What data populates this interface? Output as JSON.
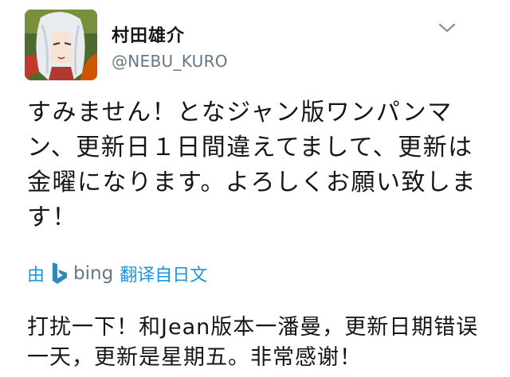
{
  "user": {
    "display_name": "村田雄介",
    "handle": "@NEBU_KURO"
  },
  "tweet": {
    "text": "すみません！となジャン版ワンパンマン、更新日１日間違えてまして、更新は金曜になります。よろしくお願い致します！"
  },
  "translation": {
    "by_label": "由",
    "provider_name": "bing",
    "link_label": "翻译自日文",
    "text": "打扰一下！和Jean版本一潘曼，更新日期错误一天，更新是星期五。非常感谢！"
  },
  "icons": {
    "menu": "chevron-down-icon",
    "provider": "bing-logo-icon"
  },
  "colors": {
    "link": "#1b95e0",
    "secondary_text": "#657786",
    "primary_text": "#14171a",
    "bing_logo": "#2b8cb7"
  }
}
